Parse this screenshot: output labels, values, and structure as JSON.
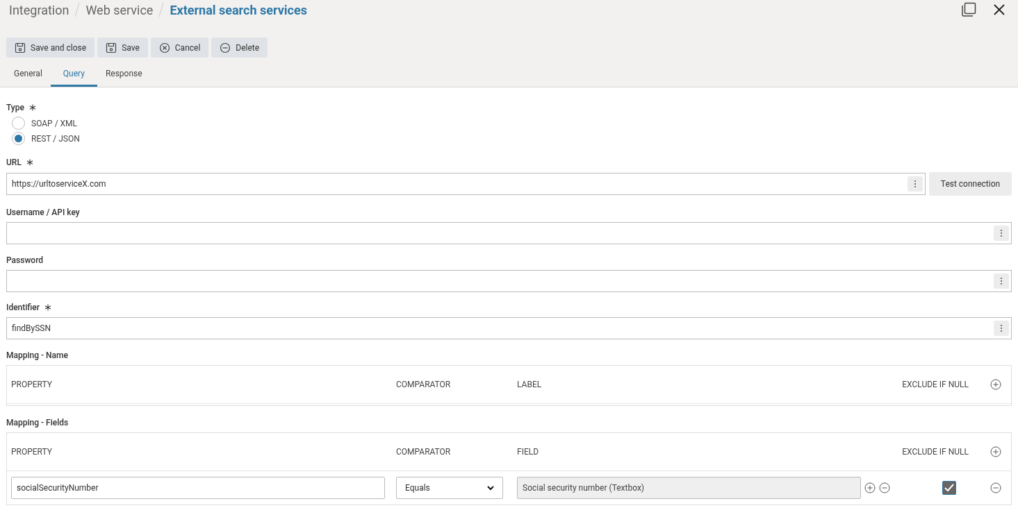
{
  "breadcrumb": [
    {
      "label": "Integration",
      "current": false
    },
    {
      "label": "Web service",
      "current": false
    },
    {
      "label": "External search services",
      "current": true
    }
  ],
  "toolbar": [
    {
      "label": "Save and close",
      "kind": "save"
    },
    {
      "label": "Save",
      "kind": "save"
    },
    {
      "label": "Cancel",
      "kind": "cancel"
    },
    {
      "label": "Delete",
      "kind": "delete"
    }
  ],
  "tabs": [
    {
      "label": "General",
      "selected": false
    },
    {
      "label": "Query",
      "selected": true
    },
    {
      "label": "Response",
      "selected": false
    }
  ],
  "type_field": {
    "label": "Type",
    "required": true,
    "options": [
      {
        "label": "SOAP / XML",
        "selected": false
      },
      {
        "label": "REST / JSON",
        "selected": true
      }
    ]
  },
  "fields": [
    {
      "label": "URL",
      "required": true,
      "value": "https://urltoserviceX.com",
      "button": "Test connection"
    },
    {
      "label": "Username / API key",
      "required": false
    },
    {
      "label": "Password",
      "required": false
    },
    {
      "label": "Identifier",
      "required": true,
      "value": "findBySSN"
    }
  ],
  "mappings": [
    {
      "title": "Mapping - Name",
      "columns": [
        "PROPERTY",
        "COMPARATOR",
        "LABEL",
        "EXCLUDE IF NULL"
      ]
    },
    {
      "title": "Mapping - Fields",
      "columns": [
        "PROPERTY",
        "COMPARATOR",
        "FIELD",
        "EXCLUDE IF NULL"
      ],
      "rows": [
        {
          "property": "socialSecurityNumber",
          "comparator": "Equals",
          "field": "Social security number (Textbox)",
          "exclude_if_null": true
        }
      ]
    }
  ]
}
